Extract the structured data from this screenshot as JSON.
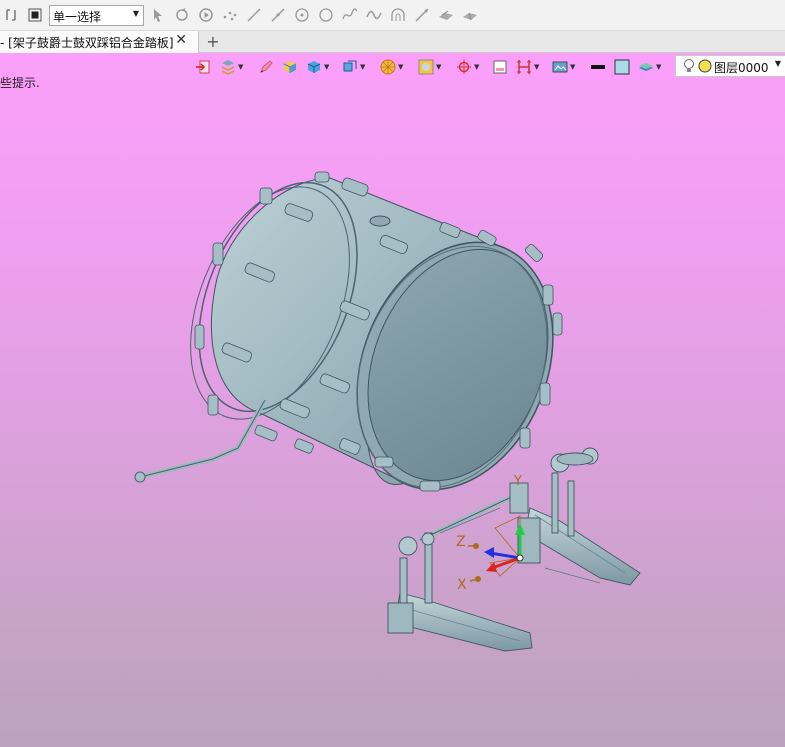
{
  "toolbar": {
    "selection_mode": "单一选择",
    "icons": [
      "repeat-icon",
      "stop-icon",
      "cursor-icon",
      "rotate-icon",
      "play-icon",
      "points-icon",
      "line-icon",
      "line2-icon",
      "point-circle-icon",
      "circle-icon",
      "spline-icon",
      "wave-icon",
      "arc-icon",
      "line3-icon",
      "surface-icon",
      "surface2-icon"
    ]
  },
  "tabs": {
    "active_tab": "- [架子鼓爵士鼓双踩铝合金踏板]",
    "close_symbol": "✕",
    "new_tab_symbol": "+"
  },
  "viewport": {
    "hint": "些提示."
  },
  "view_toolbar": {
    "layer": "图层0000"
  },
  "axes": {
    "z_label": "Z",
    "x_label": "X",
    "y_label": "Y"
  },
  "colors": {
    "model": "#9cb6bf",
    "model_dark": "#6f8d98",
    "bg_top": "#fb9ffb",
    "bg_bottom": "#bca2bc"
  }
}
